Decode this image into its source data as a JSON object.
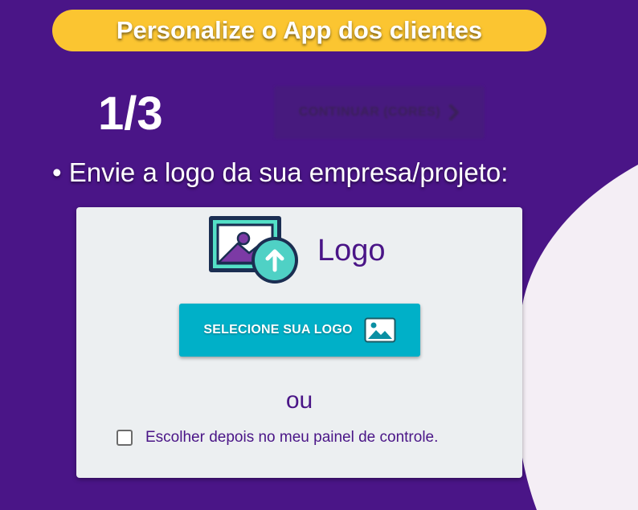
{
  "header": {
    "title": "Personalize o App dos clientes"
  },
  "step": {
    "indicator": "1/3"
  },
  "continue_button": {
    "label": "CONTINUAR (CORES)",
    "icon": "chevron-right-icon"
  },
  "instruction": {
    "text": "• Envie a logo da sua empresa/projeto:"
  },
  "upload_card": {
    "illustration_icon": "image-upload-icon",
    "title": "Logo",
    "select_button": {
      "label": "SELECIONE SUA LOGO",
      "icon": "image-icon"
    },
    "or_text": "ou",
    "later_option": {
      "label": "Escolher depois no meu painel de controle.",
      "checked": false
    }
  },
  "colors": {
    "background": "#4a1587",
    "accent_yellow": "#fbc531",
    "button_teal": "#00b0c8",
    "card_background": "#eceff1",
    "text_purple": "#4a1587",
    "curve_pink": "#f4eef5"
  }
}
